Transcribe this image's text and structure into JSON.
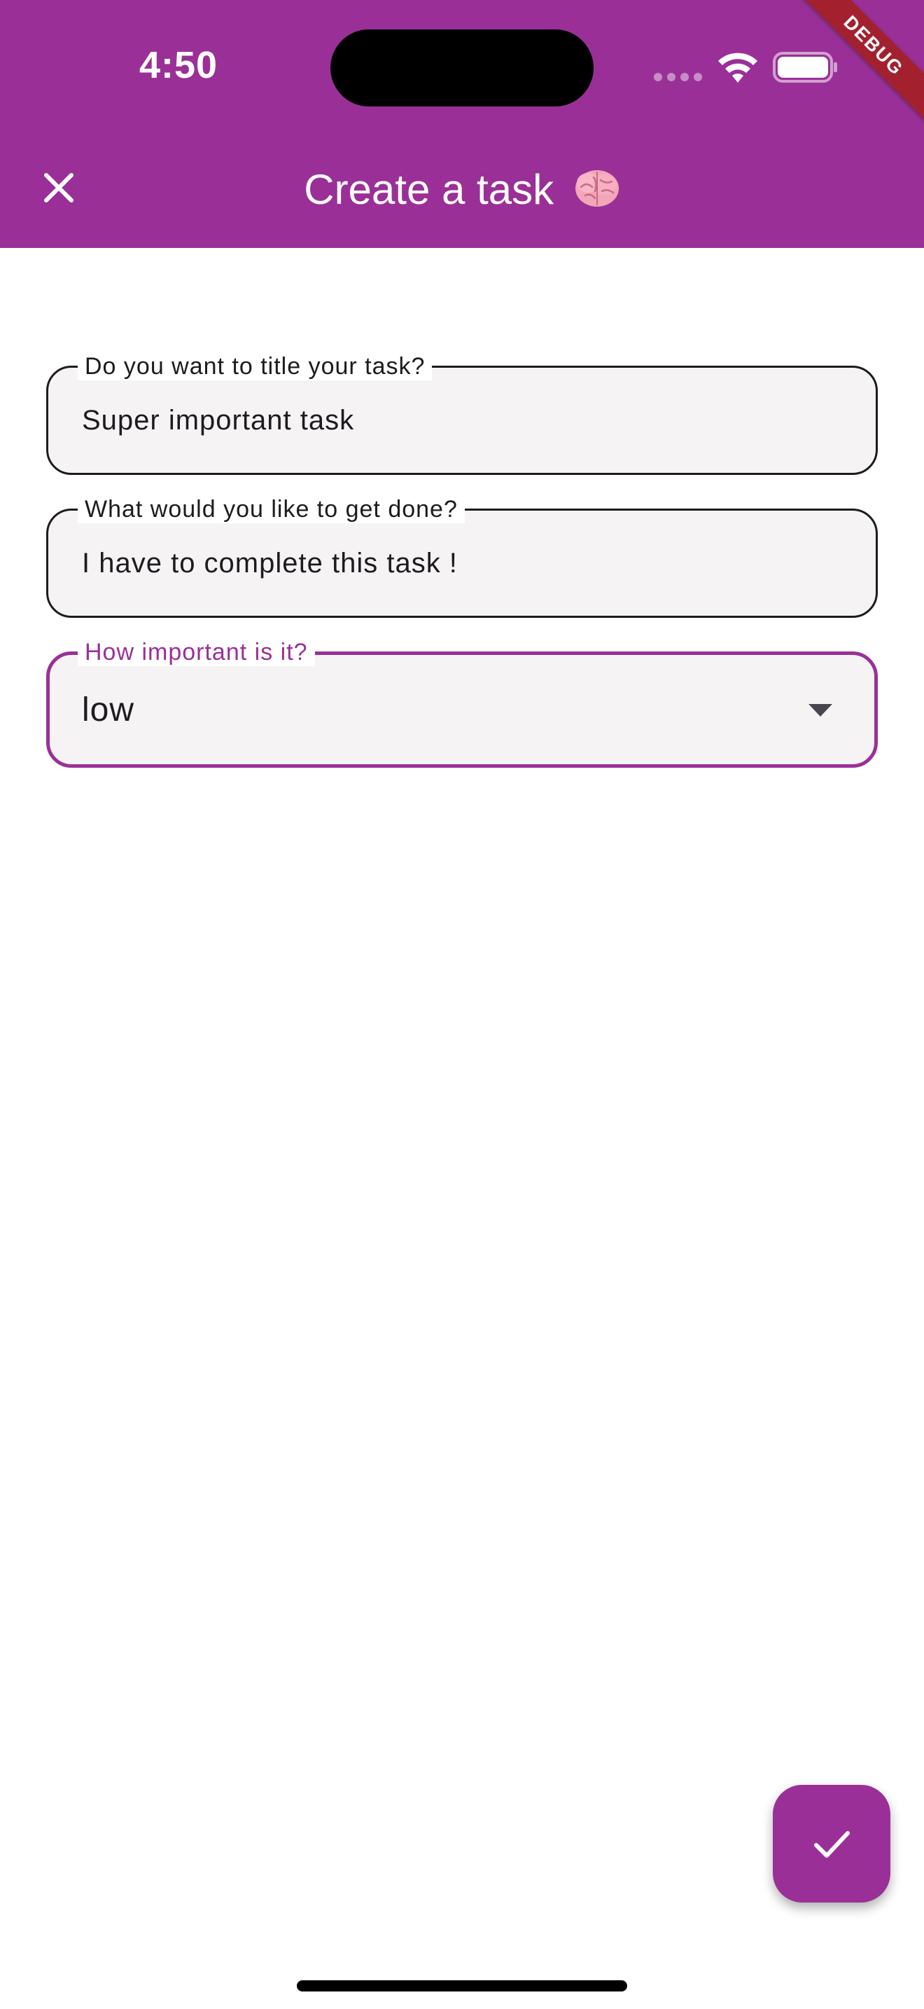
{
  "status_bar": {
    "time": "4:50"
  },
  "debug_banner": "DEBUG",
  "app_bar": {
    "title": "Create a task",
    "title_emoji_icon": "brain-icon",
    "close_icon": "close-icon",
    "background_color": "#9a3097"
  },
  "form": {
    "title_field": {
      "label": "Do you want to title your task?",
      "value": "Super important task"
    },
    "description_field": {
      "label": "What would you like to get done?",
      "value": "I have to complete this task !"
    },
    "priority_field": {
      "label": "How important is it?",
      "selected": "low",
      "accent_color": "#9a3097"
    }
  },
  "fab": {
    "icon": "check-icon",
    "color": "#9a3097"
  }
}
